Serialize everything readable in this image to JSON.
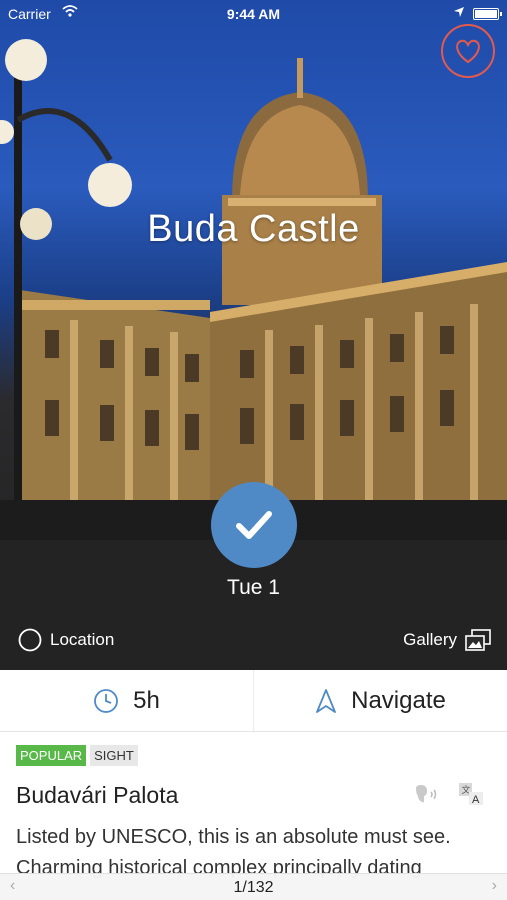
{
  "status_bar": {
    "carrier": "Carrier",
    "time": "9:44 AM"
  },
  "hero": {
    "title": "Buda Castle",
    "date_label": "Tue 1",
    "location_label": "Location",
    "gallery_label": "Gallery",
    "favorite_icon": "heart-icon",
    "check_icon": "checkmark-icon"
  },
  "info_bar": {
    "duration": "5h",
    "navigate_label": "Navigate"
  },
  "details": {
    "tags": [
      "POPULAR",
      "SIGHT"
    ],
    "name": "Budavári Palota",
    "description": "Listed by UNESCO, this is an absolute must see. Charming historical complex principally dating"
  },
  "pager": {
    "current": "1/132"
  },
  "colors": {
    "accent_blue": "#4f8ac6",
    "heart_red": "#e25a4e",
    "popular_green": "#58b848"
  }
}
